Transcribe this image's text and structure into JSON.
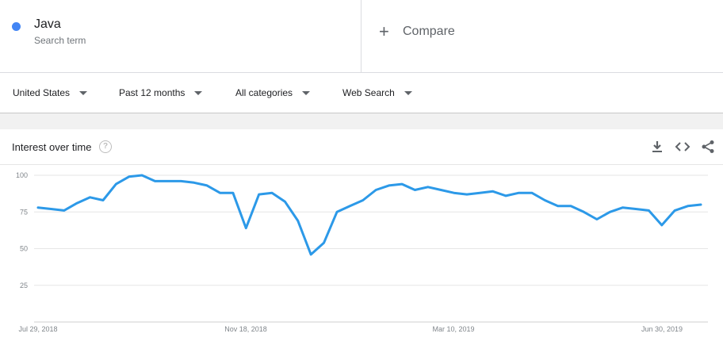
{
  "search_term": {
    "name": "Java",
    "subtitle": "Search term",
    "color": "#4285f4"
  },
  "compare": {
    "label": "Compare"
  },
  "filters": [
    {
      "label": "United States"
    },
    {
      "label": "Past 12 months"
    },
    {
      "label": "All categories"
    },
    {
      "label": "Web Search"
    }
  ],
  "card": {
    "title": "Interest over time",
    "help_icon": "question-circle-icon",
    "actions": [
      "download-icon",
      "embed-code-icon",
      "share-icon"
    ]
  },
  "chart_data": {
    "type": "line",
    "title": "",
    "xlabel": "",
    "ylabel": "",
    "ylim": [
      0,
      100
    ],
    "yticks": [
      25,
      50,
      75,
      100
    ],
    "xticks": [
      "Jul 29, 2018",
      "Nov 18, 2018",
      "Mar 10, 2019",
      "Jun 30, 2019"
    ],
    "grid": true,
    "line_color": "#2c99e8",
    "series": [
      {
        "values": [
          78,
          77,
          76,
          81,
          85,
          83,
          94,
          99,
          100,
          96,
          96,
          96,
          95,
          93,
          88,
          88,
          64,
          87,
          88,
          82,
          69,
          46,
          54,
          75,
          79,
          83,
          90,
          93,
          94,
          90,
          92,
          90,
          88,
          87,
          88,
          89,
          86,
          88,
          88,
          83,
          79,
          79,
          75,
          70,
          75,
          78,
          77,
          76,
          66,
          76,
          79,
          80
        ]
      }
    ]
  }
}
